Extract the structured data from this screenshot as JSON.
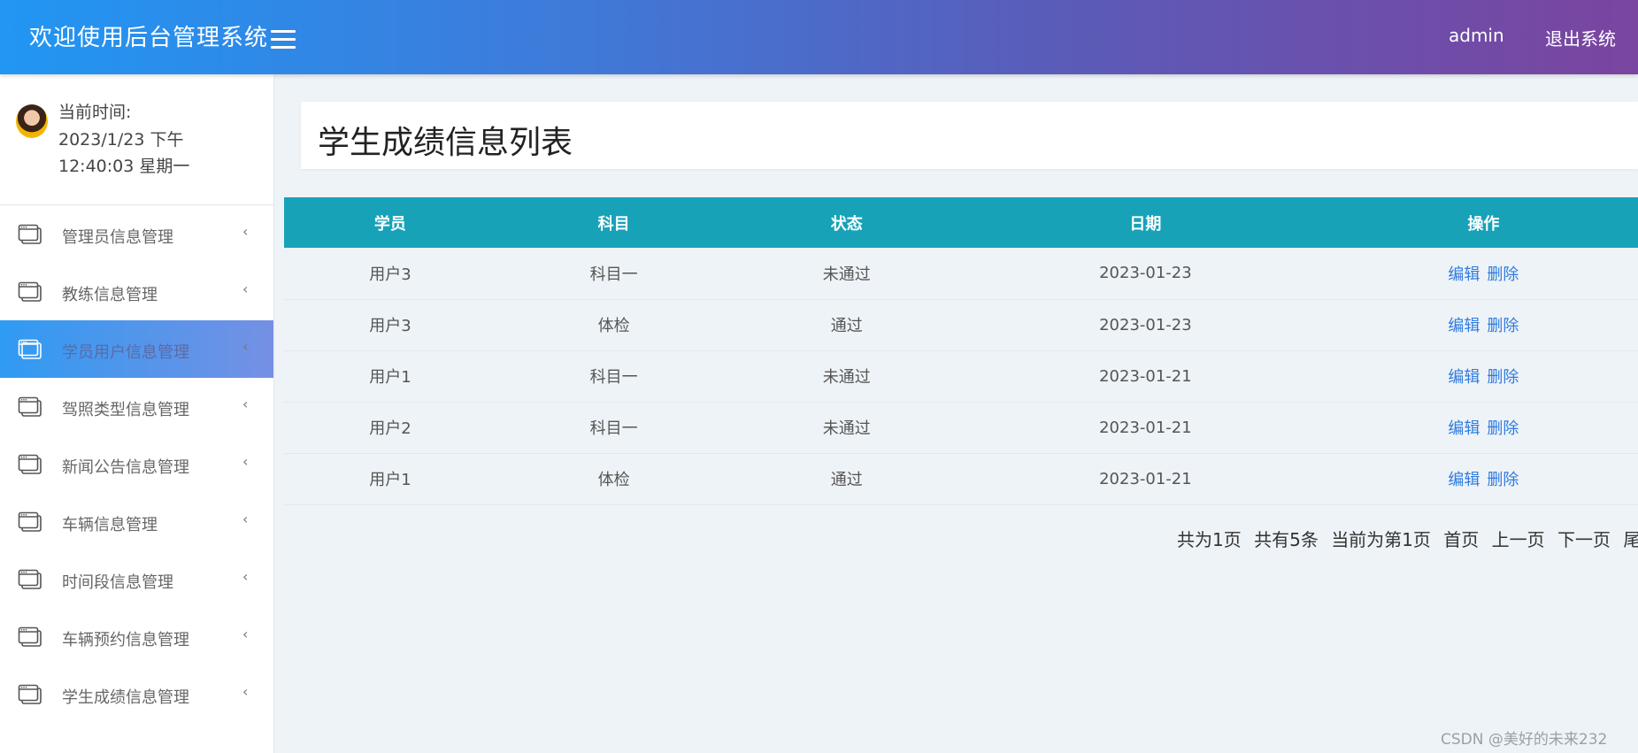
{
  "header": {
    "app_title": "欢迎使用后台管理系统",
    "username": "admin",
    "logout_label": "退出系统"
  },
  "sidebar": {
    "time_label": "当前时间:",
    "time_value": "2023/1/23 下午 12:40:03 星期一",
    "items": [
      {
        "label": "管理员信息管理",
        "icon": "window-icon",
        "active": false
      },
      {
        "label": "教练信息管理",
        "icon": "window-icon",
        "active": false
      },
      {
        "label": "学员用户信息管理",
        "icon": "window-icon",
        "active": true
      },
      {
        "label": "驾照类型信息管理",
        "icon": "window-icon",
        "active": false
      },
      {
        "label": "新闻公告信息管理",
        "icon": "window-icon",
        "active": false
      },
      {
        "label": "车辆信息管理",
        "icon": "window-icon",
        "active": false
      },
      {
        "label": "时间段信息管理",
        "icon": "window-icon",
        "active": false
      },
      {
        "label": "车辆预约信息管理",
        "icon": "window-icon",
        "active": false
      },
      {
        "label": "学生成绩信息管理",
        "icon": "window-icon",
        "active": false
      }
    ],
    "chevron": "‹"
  },
  "main": {
    "page_title": "学生成绩信息列表",
    "table": {
      "columns": [
        "学员",
        "科目",
        "状态",
        "日期",
        "操作"
      ],
      "rows": [
        {
          "student": "用户3",
          "subject": "科目一",
          "status": "未通过",
          "date": "2023-01-23"
        },
        {
          "student": "用户3",
          "subject": "体检",
          "status": "通过",
          "date": "2023-01-23"
        },
        {
          "student": "用户1",
          "subject": "科目一",
          "status": "未通过",
          "date": "2023-01-21"
        },
        {
          "student": "用户2",
          "subject": "科目一",
          "status": "未通过",
          "date": "2023-01-21"
        },
        {
          "student": "用户1",
          "subject": "体检",
          "status": "通过",
          "date": "2023-01-21"
        }
      ],
      "edit_label": "编辑",
      "delete_label": "删除"
    },
    "pager": {
      "total_pages": "共为1页",
      "total_records": "共有5条",
      "current_page": "当前为第1页",
      "first": "首页",
      "prev": "上一页",
      "next": "下一页",
      "last": "尾页"
    }
  },
  "watermark": "CSDN @美好的未来232",
  "colors": {
    "header_start": "#2196f3",
    "header_end": "#7a45a0",
    "table_header": "#17a2b8",
    "link": "#2f7be0",
    "active_menu": "#2f9bf2"
  }
}
